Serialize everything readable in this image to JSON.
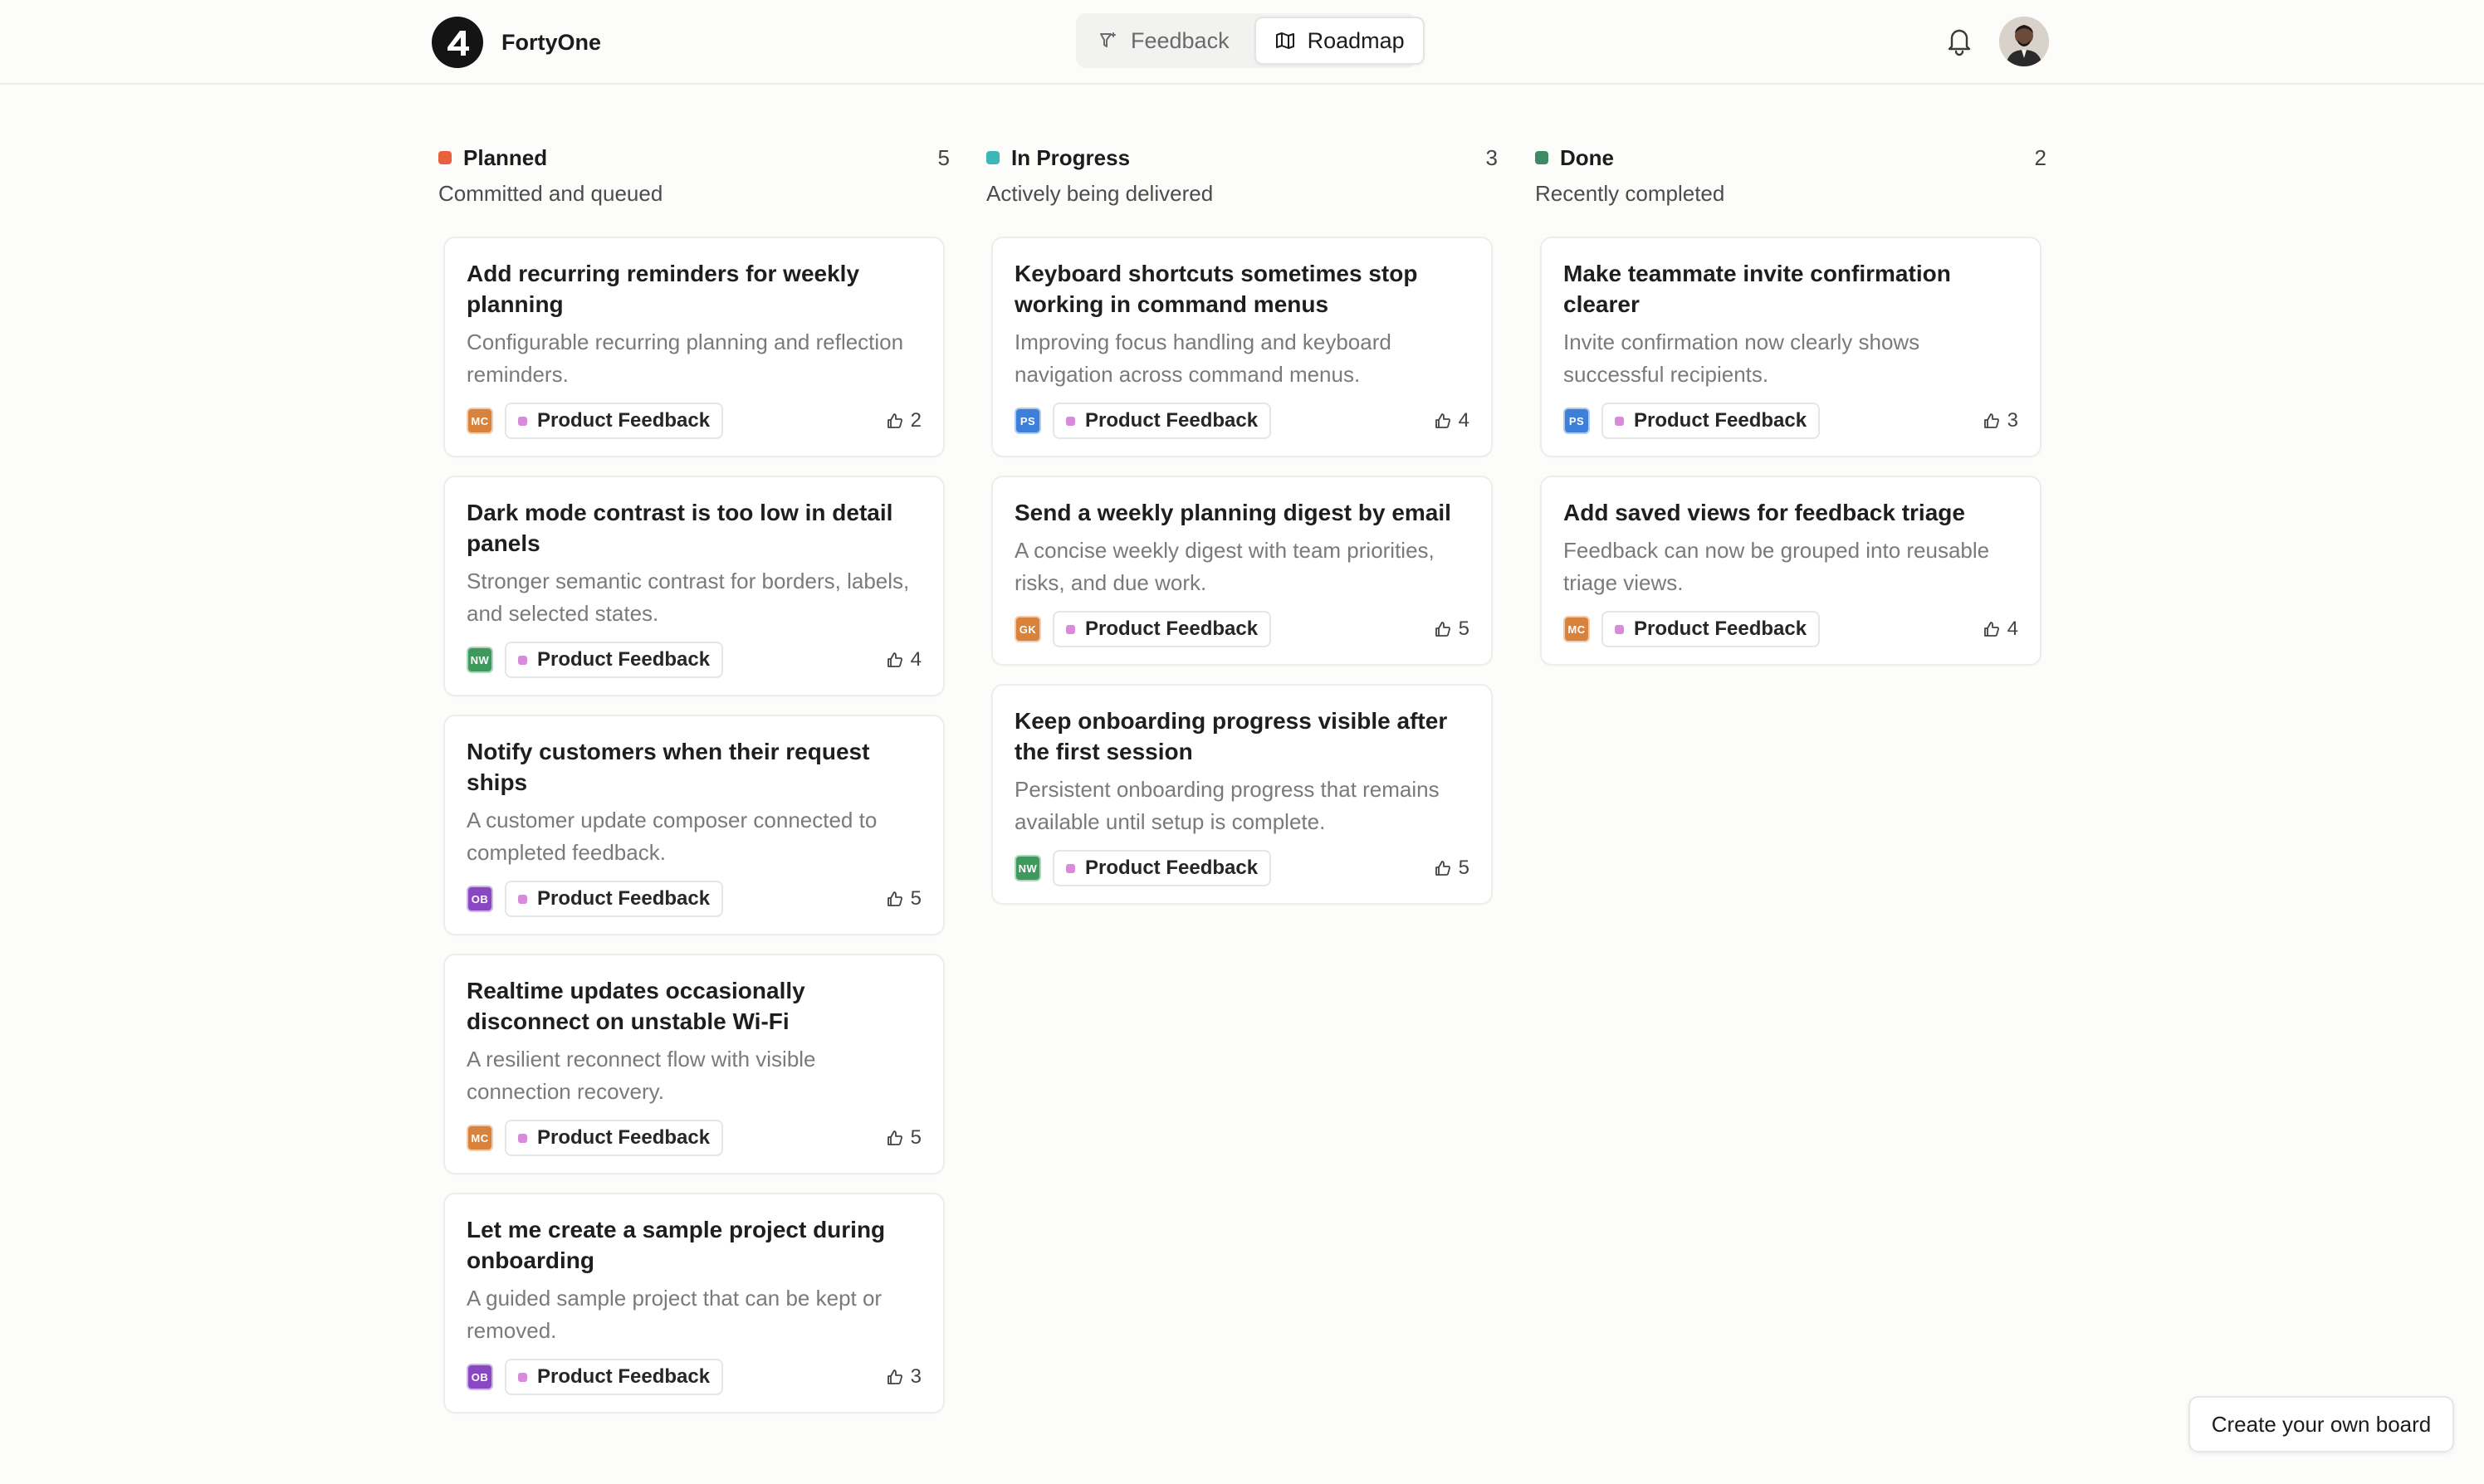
{
  "app": {
    "name": "FortyOne"
  },
  "nav": [
    {
      "label": "Feedback",
      "icon": "funnel-sparkle-icon",
      "active": false
    },
    {
      "label": "Roadmap",
      "icon": "map-icon",
      "active": true
    }
  ],
  "colors": {
    "planned": "#e8603c",
    "in_progress": "#3bb7b8",
    "done": "#3f8a64",
    "tag": "#d98bdb",
    "MC": "#d9823b",
    "NW": "#3d9a5c",
    "OB": "#8a47c2",
    "PS": "#3d7fd9",
    "GK": "#d9823b"
  },
  "columns": [
    {
      "title": "Planned",
      "count": "5",
      "subtitle": "Committed and queued",
      "cards": [
        {
          "title": "Add recurring reminders for weekly planning",
          "desc": "Configurable recurring planning and reflection reminders.",
          "initials": "MC",
          "tag": "Product Feedback",
          "votes": "2"
        },
        {
          "title": "Dark mode contrast is too low in detail panels",
          "desc": "Stronger semantic contrast for borders, labels, and selected states.",
          "initials": "NW",
          "tag": "Product Feedback",
          "votes": "4"
        },
        {
          "title": "Notify customers when their request ships",
          "desc": "A customer update composer connected to completed feedback.",
          "initials": "OB",
          "tag": "Product Feedback",
          "votes": "5"
        },
        {
          "title": "Realtime updates occasionally disconnect on unstable Wi-Fi",
          "desc": "A resilient reconnect flow with visible connection recovery.",
          "initials": "MC",
          "tag": "Product Feedback",
          "votes": "5"
        },
        {
          "title": "Let me create a sample project during onboarding",
          "desc": "A guided sample project that can be kept or removed.",
          "initials": "OB",
          "tag": "Product Feedback",
          "votes": "3"
        }
      ]
    },
    {
      "title": "In Progress",
      "count": "3",
      "subtitle": "Actively being delivered",
      "cards": [
        {
          "title": "Keyboard shortcuts sometimes stop working in command menus",
          "desc": "Improving focus handling and keyboard navigation across command menus.",
          "initials": "PS",
          "tag": "Product Feedback",
          "votes": "4"
        },
        {
          "title": "Send a weekly planning digest by email",
          "desc": "A concise weekly digest with team priorities, risks, and due work.",
          "initials": "GK",
          "tag": "Product Feedback",
          "votes": "5"
        },
        {
          "title": "Keep onboarding progress visible after the first session",
          "desc": "Persistent onboarding progress that remains available until setup is complete.",
          "initials": "NW",
          "tag": "Product Feedback",
          "votes": "5"
        }
      ]
    },
    {
      "title": "Done",
      "count": "2",
      "subtitle": "Recently completed",
      "cards": [
        {
          "title": "Make teammate invite confirmation clearer",
          "desc": "Invite confirmation now clearly shows successful recipients.",
          "initials": "PS",
          "tag": "Product Feedback",
          "votes": "3"
        },
        {
          "title": "Add saved views for feedback triage",
          "desc": "Feedback can now be grouped into reusable triage views.",
          "initials": "MC",
          "tag": "Product Feedback",
          "votes": "4"
        }
      ]
    }
  ],
  "cta": {
    "label": "Create your own board"
  }
}
